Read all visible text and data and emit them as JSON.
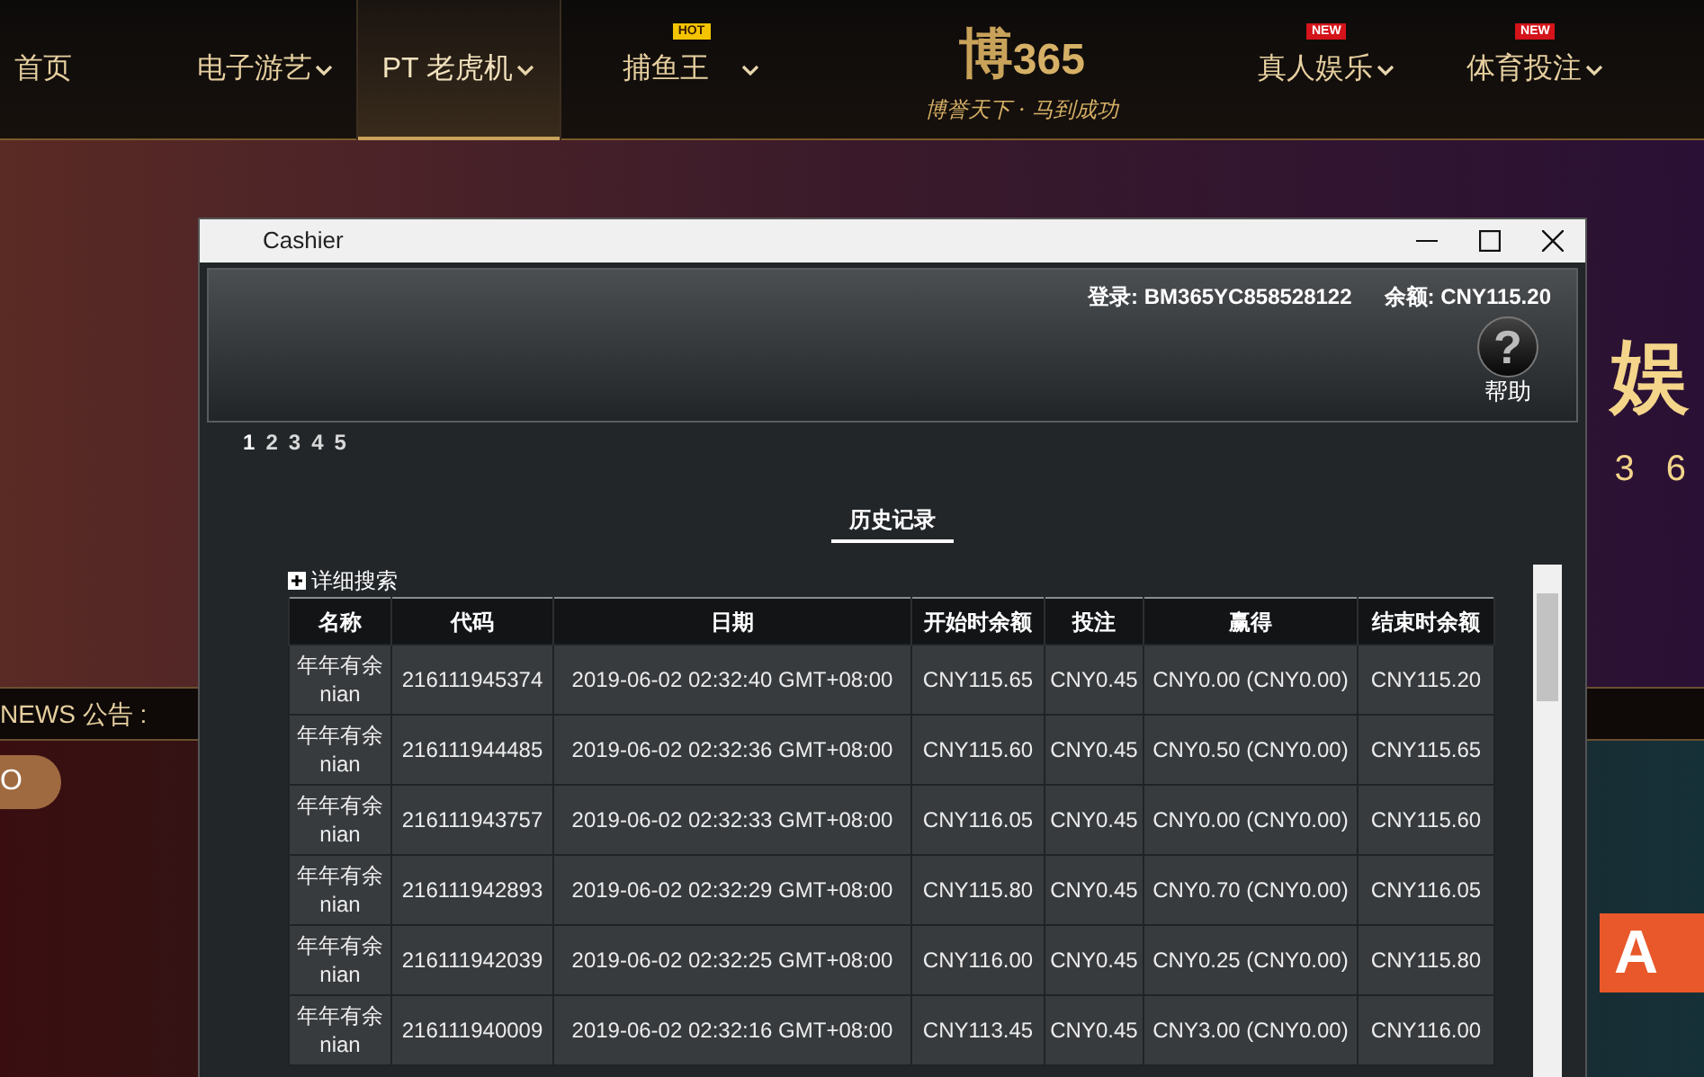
{
  "nav": {
    "items": [
      {
        "label": "首页",
        "has_dropdown": false,
        "selected": false
      },
      {
        "label": "电子游艺",
        "has_dropdown": true,
        "selected": false
      },
      {
        "label": "PT 老虎机",
        "has_dropdown": true,
        "selected": true
      },
      {
        "label": "捕鱼王",
        "has_dropdown": true,
        "selected": false,
        "badge": {
          "text": "HOT",
          "kind": "hot",
          "color": "#f5c400"
        }
      }
    ],
    "right_items": [
      {
        "label": "真人娱乐",
        "has_dropdown": true,
        "selected": false,
        "badge": {
          "text": "NEW",
          "kind": "new",
          "color": "#d4131a"
        }
      },
      {
        "label": "体育投注",
        "has_dropdown": true,
        "selected": false,
        "badge": {
          "text": "NEW",
          "kind": "new",
          "color": "#d4131a"
        }
      }
    ],
    "logo": {
      "mark": "博",
      "number": "365",
      "tagline": "博誉天下 · 马到成功"
    }
  },
  "banner": {
    "headline": "娱",
    "subline": "3 6"
  },
  "news": {
    "label": "NEWS 公告 :"
  },
  "lower": {
    "button": "O",
    "partner_logo": "A"
  },
  "cashier": {
    "title": "Cashier",
    "login": "登录: BM365YC858528122",
    "balance": "余额: CNY115.20",
    "help": {
      "glyph": "?",
      "label": "帮助"
    },
    "pages": [
      {
        "label": "1",
        "selected": true
      },
      {
        "label": "2",
        "selected": false
      },
      {
        "label": "3",
        "selected": false
      },
      {
        "label": "4",
        "selected": false
      },
      {
        "label": "5",
        "selected": false
      }
    ],
    "tabs": [
      {
        "label": "历史记录",
        "selected": true
      }
    ],
    "advanced_search": {
      "label": "详细搜索",
      "expanded": false
    },
    "table": {
      "columns": [
        "名称",
        "代码",
        "日期",
        "开始时余额",
        "投注",
        "赢得",
        "结束时余额"
      ],
      "rows": [
        [
          "年年有余 nian",
          "216111945374",
          "2019-06-02 02:32:40 GMT+08:00",
          "CNY115.65",
          "CNY0.45",
          "CNY0.00 (CNY0.00)",
          "CNY115.20"
        ],
        [
          "年年有余 nian",
          "216111944485",
          "2019-06-02 02:32:36 GMT+08:00",
          "CNY115.60",
          "CNY0.45",
          "CNY0.50 (CNY0.00)",
          "CNY115.65"
        ],
        [
          "年年有余 nian",
          "216111943757",
          "2019-06-02 02:32:33 GMT+08:00",
          "CNY116.05",
          "CNY0.45",
          "CNY0.00 (CNY0.00)",
          "CNY115.60"
        ],
        [
          "年年有余 nian",
          "216111942893",
          "2019-06-02 02:32:29 GMT+08:00",
          "CNY115.80",
          "CNY0.45",
          "CNY0.70 (CNY0.00)",
          "CNY116.05"
        ],
        [
          "年年有余 nian",
          "216111942039",
          "2019-06-02 02:32:25 GMT+08:00",
          "CNY116.00",
          "CNY0.45",
          "CNY0.25 (CNY0.00)",
          "CNY115.80"
        ],
        [
          "年年有余 nian",
          "216111940009",
          "2019-06-02 02:32:16 GMT+08:00",
          "CNY113.45",
          "CNY0.45",
          "CNY3.00 (CNY0.00)",
          "CNY116.00"
        ]
      ]
    }
  }
}
